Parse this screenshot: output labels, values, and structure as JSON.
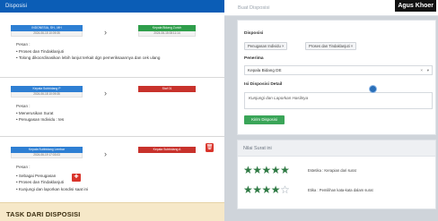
{
  "left": {
    "header": "Disposisi",
    "entries": [
      {
        "from_label": "INDONESIA, SH., MH",
        "from_time": "2024-06-15 10:09:35",
        "to_label": "Kepala Bidang Zurich",
        "to_time": "2024-06-15 08:11:14",
        "pesan_label": "Pesan :",
        "items": [
          "Proses dan Tindaklanjuti",
          "Tolong dikoordinasikan lebih lanjut terkait dgn pemeriksaannya dan cek ulang"
        ]
      },
      {
        "from_label": "Kepala Subbidang P",
        "from_time": "2024-06-18 10:09:35",
        "to_label": "Staf 01",
        "to_time": "",
        "pesan_label": "Pesan :",
        "items": [
          "Menerusikan Surat",
          "Penugasan Individu : tes"
        ]
      },
      {
        "from_label": "Kepala Subbidang Lembar",
        "from_time": "2024-06-19 17:03:03",
        "to_label": "Kepala Subbidang A",
        "to_time": "",
        "pesan_label": "Pesan :",
        "items": [
          "Sebagai Penugasan",
          "Proses dan Tindaklanjuti",
          "Kunjungi dan laporkan kondisi saat ini"
        ]
      }
    ],
    "task_title": "TASK DARI DISPOSISI"
  },
  "right": {
    "header_title": "Buat Disposisi",
    "user_name": "Agus Khoer",
    "disposisi_label": "Disposisi",
    "disposisi_tags": [
      "Penugasan Individu  ×",
      "Proses dan Tindaklanjuti  ×"
    ],
    "penerima_label": "Penerima",
    "penerima_value": "Kepala Bidang DE",
    "clear_symbol": "×",
    "chevron_symbol": "▾",
    "detail_label": "Isi Disposisi Detail",
    "detail_value": "Kunjungi dan Laporkan Hasilnya",
    "submit_label": "Kirim Disposisi",
    "rating_title": "Nilai Surat ini",
    "ratings": [
      {
        "score": 5,
        "max": 5,
        "label": "Estetika : Kerapian dari surat"
      },
      {
        "score": 4,
        "max": 5,
        "label": "Etika : Pemilihan kata-kata dalam surat"
      }
    ],
    "colors": {
      "accent": "#0b5db6",
      "success": "#3aa558",
      "danger": "#d9342b",
      "star": "#2f7a44"
    }
  }
}
